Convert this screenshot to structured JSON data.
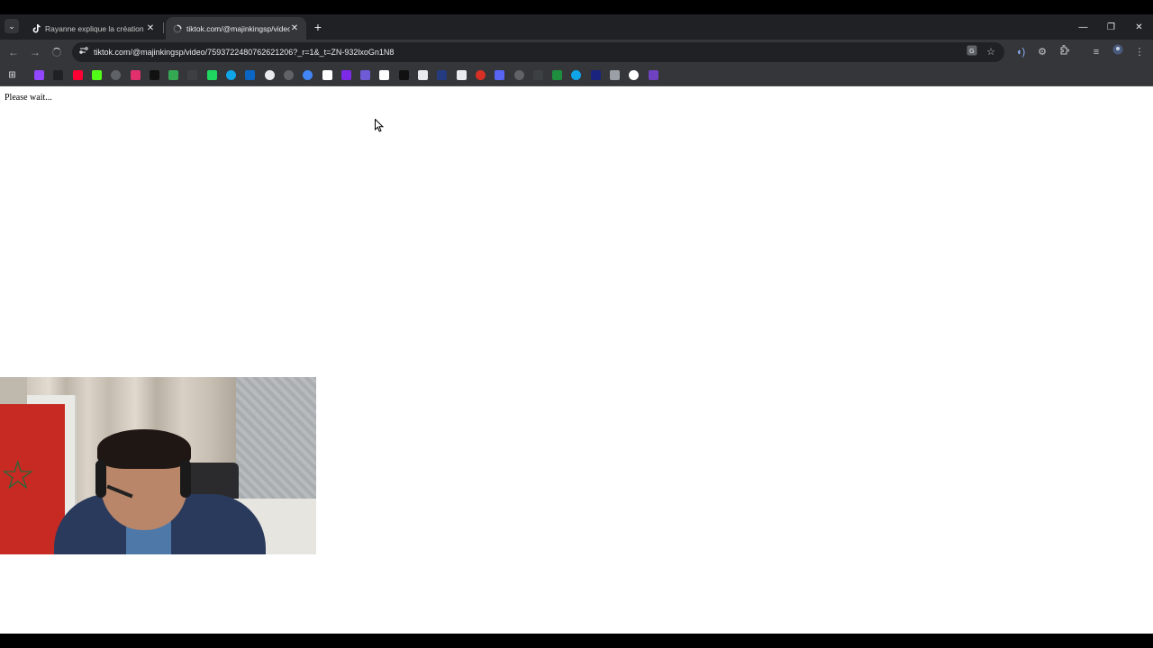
{
  "browser": {
    "tabs": [
      {
        "title": "Rayanne explique la création de",
        "favicon": "tiktok-icon",
        "active": false
      },
      {
        "title": "tiktok.com/@majinkingsp/video",
        "favicon": "loading-icon",
        "active": true
      }
    ],
    "new_tab_glyph": "+",
    "window_controls": {
      "minimize": "—",
      "restore": "❐",
      "close": "✕"
    },
    "address_bar": {
      "url": "tiktok.com/@majinkingsp/video/7593722480762621206?_r=1&_t=ZN-932lxoGn1N8"
    },
    "bookmarks": [
      {
        "icon": "twitch-icon",
        "color": "#9146ff"
      },
      {
        "icon": "x-icon",
        "color": "#202124"
      },
      {
        "icon": "youtube-icon",
        "color": "#ff0033"
      },
      {
        "icon": "kick-icon",
        "color": "#53fc18"
      },
      {
        "icon": "globe-icon",
        "color": "#5f6368"
      },
      {
        "icon": "instagram-icon",
        "color": "#e1306c"
      },
      {
        "icon": "tiktok-icon",
        "color": "#111111"
      },
      {
        "icon": "gamepad-icon",
        "color": "#34a853"
      },
      {
        "icon": "text-logo-icon",
        "color": "#3c4043"
      },
      {
        "icon": "chat-icon",
        "color": "#1ed760"
      },
      {
        "icon": "edge-icon",
        "color": "#0ea5e9"
      },
      {
        "icon": "linkedin-icon",
        "color": "#0a66c2"
      },
      {
        "icon": "info-icon",
        "color": "#e8eaed"
      },
      {
        "icon": "openai-icon",
        "color": "#5f6368"
      },
      {
        "icon": "google-icon",
        "color": "#4285f4"
      },
      {
        "icon": "camera-icon",
        "color": "#ffffff"
      },
      {
        "icon": "canva-icon",
        "color": "#7d2ae8"
      },
      {
        "icon": "sl-icon",
        "color": "#6f5bd6"
      },
      {
        "icon": "notion-icon",
        "color": "#ffffff"
      },
      {
        "icon": "capcut-icon",
        "color": "#111111"
      },
      {
        "icon": "dots-icon",
        "color": "#e8eaed"
      },
      {
        "icon": "paypal-icon",
        "color": "#253b80"
      },
      {
        "icon": "sparkle-icon",
        "color": "#e8eaed"
      },
      {
        "icon": "red-dot-icon",
        "color": "#d93025"
      },
      {
        "icon": "chat-bubble-icon",
        "color": "#5865f2"
      },
      {
        "icon": "globe-alt-icon",
        "color": "#5f6368"
      },
      {
        "icon": "shield-icon",
        "color": "#3c4043"
      },
      {
        "icon": "terminal-icon",
        "color": "#1e8e3e"
      },
      {
        "icon": "edge-alt-icon",
        "color": "#0ea5e9"
      },
      {
        "icon": "image-icon",
        "color": "#1a237e"
      },
      {
        "icon": "stack-icon",
        "color": "#9aa0a6"
      },
      {
        "icon": "record-icon",
        "color": "#ffffff"
      },
      {
        "icon": "chat-square-icon",
        "color": "#6f42c1"
      }
    ]
  },
  "page": {
    "message": "Please wait..."
  },
  "overlay": {
    "kind": "webcam-feed"
  }
}
